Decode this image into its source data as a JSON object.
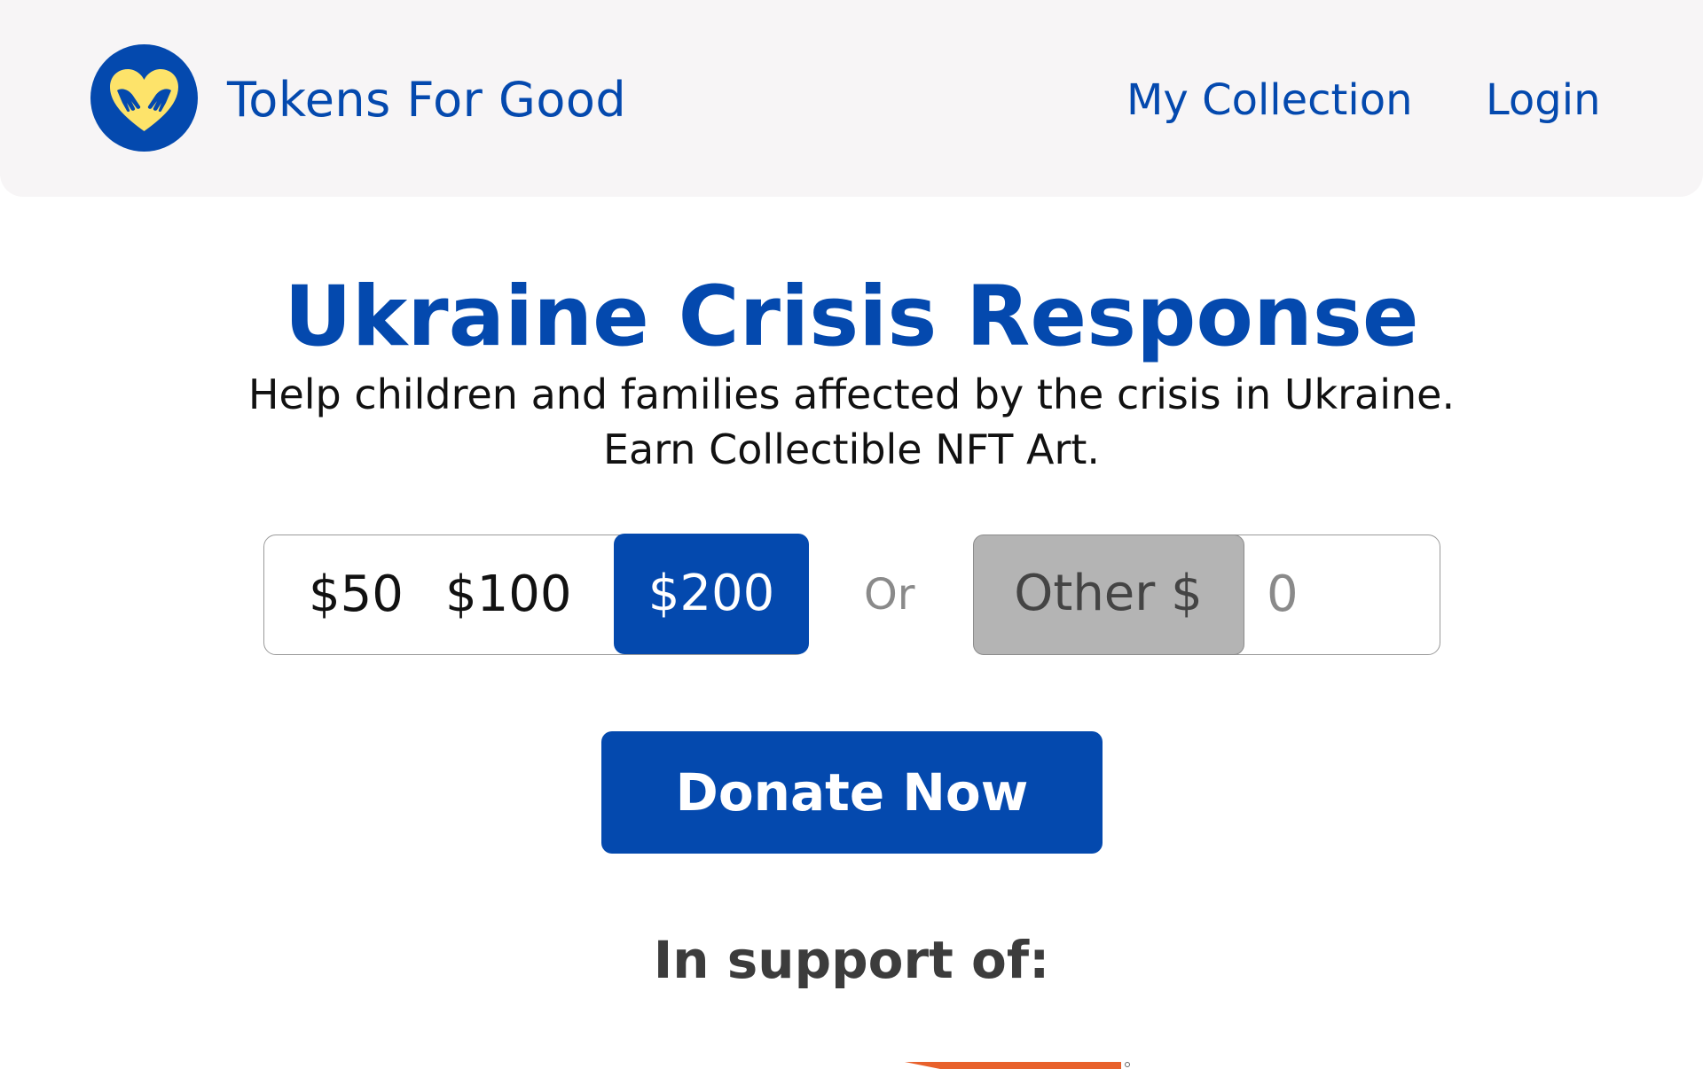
{
  "header": {
    "brand": "Tokens For Good",
    "logo_icon": "heart-hands-icon",
    "nav": {
      "collection": "My Collection",
      "login": "Login"
    }
  },
  "hero": {
    "title": "Ukraine Crisis Response",
    "subtitle_line1": "Help children and families affected by the crisis in Ukraine.",
    "subtitle_line2": "Earn Collectible NFT Art."
  },
  "donation": {
    "amounts": [
      "$50",
      "$100",
      "$200"
    ],
    "selected": "$200",
    "or_label": "Or",
    "other_label": "Other $",
    "other_value": "0",
    "donate_label": "Donate Now"
  },
  "support": {
    "heading": "In support of:"
  },
  "colors": {
    "brand_blue": "#0449ae",
    "logo_yellow": "#fde36a",
    "header_bg": "#f7f5f6",
    "other_bg": "#b4b4b4",
    "partner_orange": "#e8612c"
  }
}
